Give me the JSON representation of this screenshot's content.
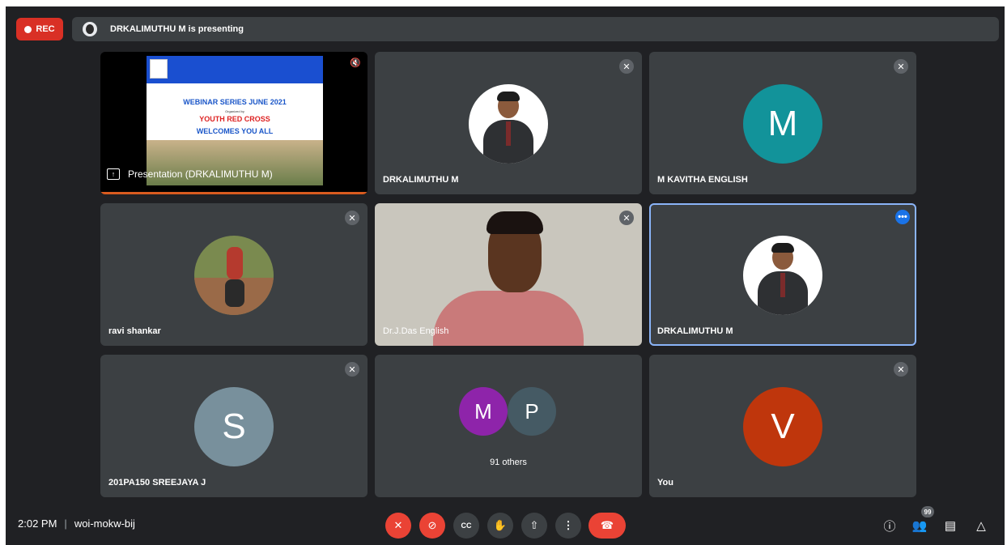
{
  "topbar": {
    "rec_label": "REC",
    "presenting_text": "DRKALIMUTHU M is presenting"
  },
  "presentation": {
    "label": "Presentation (DRKALIMUTHU M)",
    "slide_lines": [
      "WEBINAR SERIES JUNE 2021",
      "Organized by",
      "YOUTH RED CROSS",
      "WELCOMES YOU ALL"
    ]
  },
  "tiles": [
    {
      "name": "DRKALIMUTHU M",
      "muted": true
    },
    {
      "name": "M KAVITHA ENGLISH",
      "initial": "M",
      "avatar_color": "#12939a",
      "muted": true
    },
    {
      "name": "ravi shankar",
      "muted": true
    },
    {
      "name": "Dr.J.Das English",
      "muted": true
    },
    {
      "name": "DRKALIMUTHU M",
      "selected": true
    },
    {
      "name": "201PA150 SREEJAYA J",
      "initial": "S",
      "avatar_color": "#78909c",
      "muted": true
    },
    {
      "others_label": "91 others",
      "initials": [
        "M",
        "P"
      ],
      "colors": [
        "#8e24aa",
        "#455a64"
      ]
    },
    {
      "name": "You",
      "initial": "V",
      "avatar_color": "#bf360c",
      "muted": true
    }
  ],
  "bottombar": {
    "time": "2:02 PM",
    "meeting_code": "woi-mokw-bij",
    "participants_badge": "99"
  },
  "icons": [
    "mic-off-icon",
    "camera-off-icon",
    "captions-icon",
    "raise-hand-icon",
    "present-icon",
    "more-options-icon",
    "end-call-icon",
    "info-icon",
    "people-icon",
    "chat-icon",
    "activities-icon"
  ]
}
